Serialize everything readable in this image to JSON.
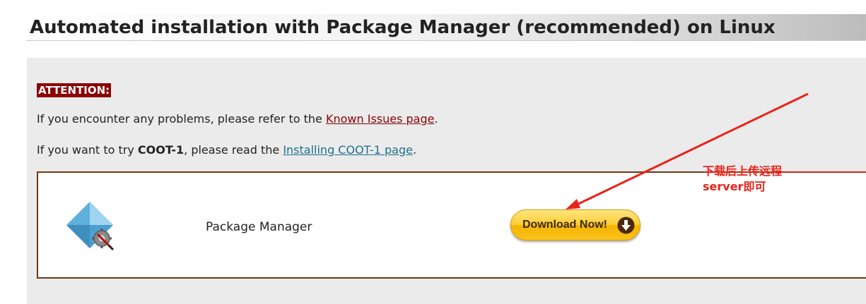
{
  "title": "Automated installation with Package Manager (recommended) on Linux",
  "attention_label": "ATTENTION:",
  "line1": {
    "prefix": "If you encounter any problems, please refer to the ",
    "link": "Known Issues page",
    "suffix": "."
  },
  "line2": {
    "prefix": "If you want to try ",
    "bold": "COOT-1",
    "middle": ", please read the ",
    "link": "Installing COOT-1 page",
    "suffix": "."
  },
  "package": {
    "icon": "package-manager-icon",
    "label": "Package Manager",
    "download_label": "Download Now!",
    "download_icon": "down-arrow-circle-icon"
  },
  "annotation": {
    "line1": "下载后上传远程",
    "line2": "server即可",
    "color": "#e8231a"
  },
  "colors": {
    "attention_bg": "#8b0000",
    "link_known_issues": "#8b0000",
    "link_install": "#1f6f8b",
    "box_border": "#6b3a12",
    "button": "#ffcc33"
  }
}
